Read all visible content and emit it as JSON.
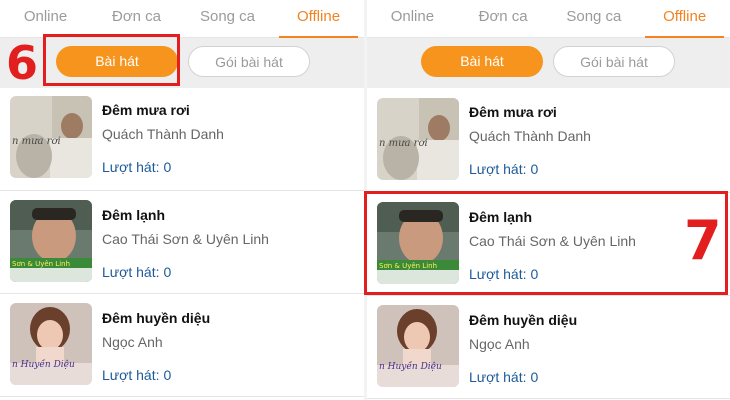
{
  "tabs": [
    "Online",
    "Đơn ca",
    "Song ca",
    "Offline"
  ],
  "active_tab": "Offline",
  "filters": {
    "songs_label": "Bài hát",
    "packages_label": "Gói bài hát"
  },
  "plays_label": "Lượt hát:",
  "songs": [
    {
      "title": "Đêm mưa rơi",
      "artist": "Quách Thành Danh",
      "plays": "0",
      "thumb_text": "n mưa rơi"
    },
    {
      "title": "Đêm lạnh",
      "artist": "Cao Thái Sơn & Uyên Linh",
      "plays": "0",
      "thumb_text": "Sơn & Uyên Linh"
    },
    {
      "title": "Đêm huyền diệu",
      "artist": "Ngọc Anh",
      "plays": "0",
      "thumb_text": "n Huyền Diệu"
    }
  ],
  "annotations": {
    "step_left": "6",
    "step_right": "7"
  },
  "colors": {
    "accent": "#f58220",
    "highlight": "#e31e1e",
    "plays": "#1e5a99"
  }
}
